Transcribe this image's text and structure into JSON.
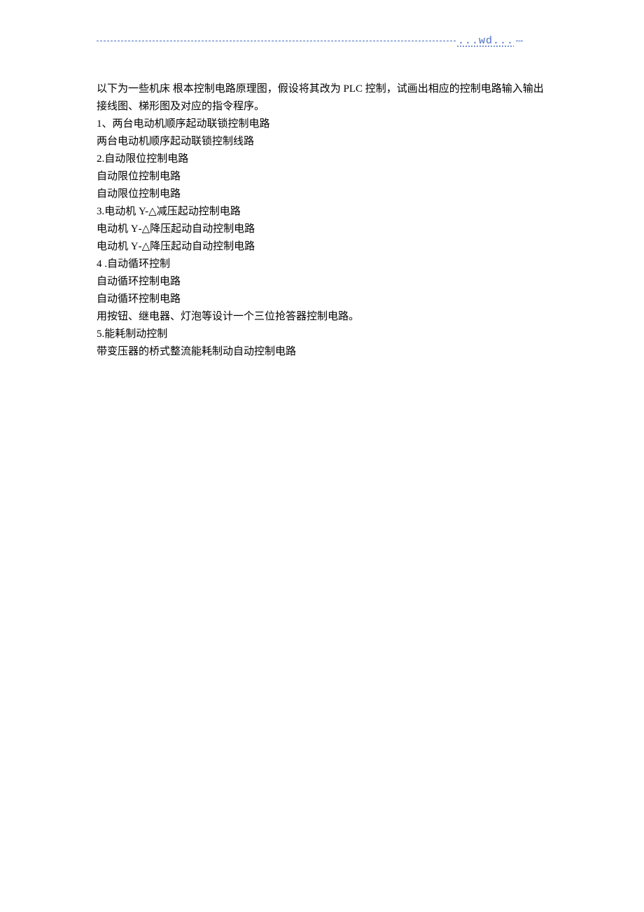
{
  "header": {
    "label": "...wd..."
  },
  "content": {
    "intro": "以下为一些机床 根本控制电路原理图，假设将其改为 PLC 控制，试画出相应的控制电路输入输出接线图、梯形图及对应的指令程序。",
    "lines": [
      "1、两台电动机顺序起动联锁控制电路",
      "两台电动机顺序起动联锁控制线路",
      "2.自动限位控制电路",
      "自动限位控制电路",
      "自动限位控制电路",
      "3.电动机 Y-△减压起动控制电路",
      "电动机 Y‐△降压起动自动控制电路",
      "电动机 Y‐△降压起动自动控制电路",
      "4 .自动循环控制",
      "自动循环控制电路",
      "自动循环控制电路",
      "用按钮、继电器、灯泡等设计一个三位抢答器控制电路。",
      "5.能耗制动控制",
      "带变压器的桥式整流能耗制动自动控制电路"
    ]
  }
}
